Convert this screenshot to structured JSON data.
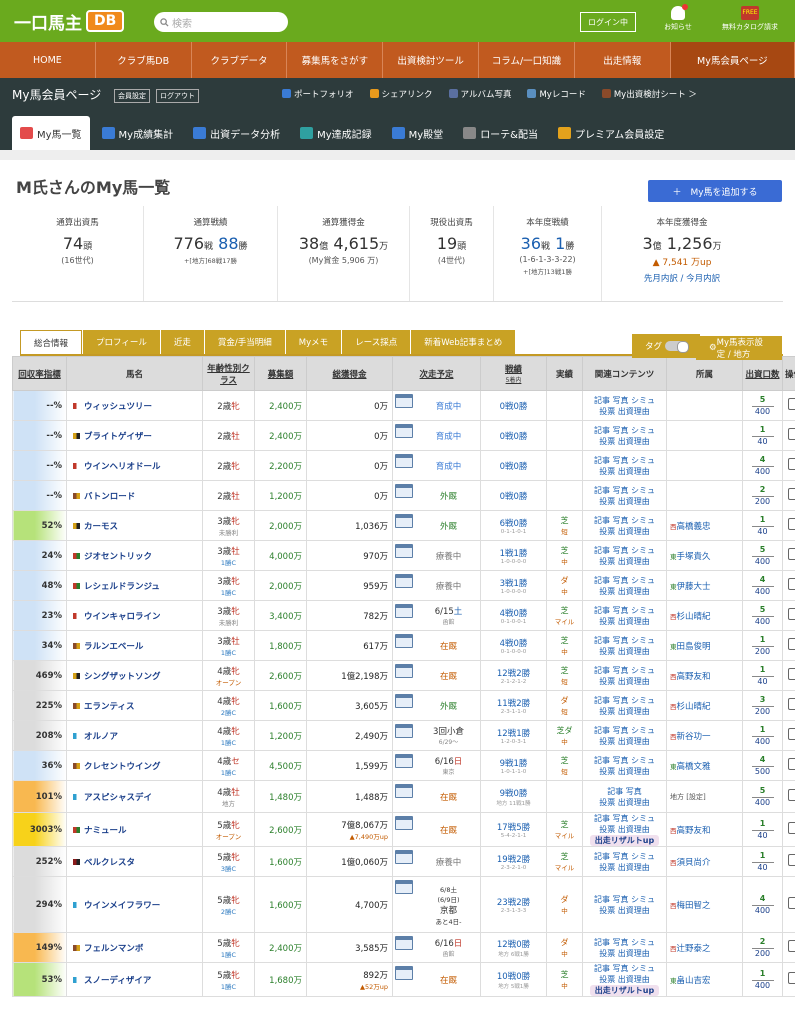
{
  "header": {
    "logo_text": "一口馬主",
    "logo_badge": "DB",
    "search_placeholder": "検索",
    "login_label": "ログイン中",
    "notice_label": "お知らせ",
    "catalog_label": "無料カタログ請求",
    "catalog_badge": "FREE"
  },
  "mainnav": [
    "HOME",
    "クラブ馬DB",
    "クラブデータ",
    "募集馬をさがす",
    "出資検討ツール",
    "コラム/一口知識",
    "出走情報",
    "My馬会員ページ"
  ],
  "subbar": {
    "title": "My馬会員ページ",
    "settings_label": "会員設定",
    "logout_label": "ログアウト",
    "links": [
      "ポートフォリオ",
      "シェアリンク",
      "アルバム写真",
      "Myレコード",
      "My出資検討シート ＞"
    ]
  },
  "tabs": [
    "My馬一覧",
    "My成績集計",
    "出資データ分析",
    "My達成記録",
    "My殿堂",
    "ローテ&配当",
    "プレミアム会員設定"
  ],
  "page": {
    "title": "M氏さんのMy馬一覧",
    "add_button": "＋　My馬を追加する"
  },
  "stats": [
    {
      "label": "通算出資馬",
      "v1": "74",
      "u1": "頭",
      "sub": "(16世代)"
    },
    {
      "label": "通算戦績",
      "v1": "776",
      "u1": "戦",
      "v2": "88",
      "u2": "勝",
      "sub": "+[地方]68戦17勝"
    },
    {
      "label": "通算獲得金",
      "v1": "38",
      "u1": "億",
      "v2": "4,615",
      "u2": "万",
      "sub": "(My賞金 5,906 万)"
    },
    {
      "label": "現役出資馬",
      "v1": "19",
      "u1": "頭",
      "sub": "(4世代)"
    },
    {
      "label": "本年度戦績",
      "v1": "36",
      "u1": "戦",
      "v2": "1",
      "u2": "勝",
      "sub": "(1-6-1-3-3-22)",
      "sub2": "+[地方]13戦1勝"
    },
    {
      "label": "本年度獲得金",
      "v1": "3",
      "u1": "億",
      "v2": "1,256",
      "u2": "万",
      "up": "7,541 万up",
      "link": "先月内訳 / 今月内訳"
    }
  ],
  "subtabs": [
    "総合情報",
    "プロフィール",
    "近走",
    "賞金/手当明細",
    "Myメモ",
    "レース採点",
    "新着Web記事まとめ"
  ],
  "toggle_label": "タグ",
  "display_settings": "My馬表示設定 / 地方",
  "columns": [
    "回収率指標",
    "馬名",
    "年齢性別クラス",
    "募集額",
    "総獲得金",
    "次走予定",
    "戦績",
    "実績",
    "関連コンテンツ",
    "所属",
    "出資口数",
    "操作"
  ],
  "columns_sub": {
    "record": "5着内"
  },
  "colors": {
    "green": "#6aaa1e",
    "orange": "#c15a1f",
    "dark": "#2d3b3c",
    "gold": "#c9a224",
    "link": "#1a5fb0"
  },
  "horses": [
    {
      "rate": "--%",
      "name": "ウィッシュツリー",
      "age": "2歳",
      "sex": "牝",
      "cls": "",
      "price": "2,400万",
      "earn": "0万",
      "earn_up": "",
      "next": "育成中",
      "next_sub": "",
      "rec": "0戦0勝",
      "rec_sub": "",
      "surf": "",
      "dist": "",
      "links": "記事 写真 シミュ|投票 出資理由",
      "badge": "",
      "stable": "",
      "stable_east": "",
      "sh": "5",
      "tot": "400",
      "tint": "#cfe2f6"
    },
    {
      "rate": "--%",
      "name": "ブライトゲイザー",
      "age": "2歳",
      "sex": "牡",
      "cls": "",
      "price": "2,400万",
      "earn": "0万",
      "earn_up": "",
      "next": "育成中",
      "next_sub": "",
      "rec": "0戦0勝",
      "rec_sub": "",
      "surf": "",
      "dist": "",
      "links": "記事 写真 シミュ|投票 出資理由",
      "badge": "",
      "stable": "",
      "stable_east": "",
      "sh": "1",
      "tot": "40",
      "tint": "#cfe2f6"
    },
    {
      "rate": "--%",
      "name": "ウインヘリオドール",
      "age": "2歳",
      "sex": "牝",
      "cls": "",
      "price": "2,200万",
      "earn": "0万",
      "earn_up": "",
      "next": "育成中",
      "next_sub": "",
      "rec": "0戦0勝",
      "rec_sub": "",
      "surf": "",
      "dist": "",
      "links": "記事 写真 シミュ|投票 出資理由",
      "badge": "",
      "stable": "",
      "stable_east": "",
      "sh": "4",
      "tot": "400",
      "tint": "#cfe2f6"
    },
    {
      "rate": "--%",
      "name": "バトンロード",
      "age": "2歳",
      "sex": "牡",
      "cls": "",
      "price": "1,200万",
      "earn": "0万",
      "earn_up": "",
      "next": "外厩",
      "next_sub": "",
      "rec": "0戦0勝",
      "rec_sub": "",
      "surf": "",
      "dist": "",
      "links": "記事 写真 シミュ|投票 出資理由",
      "badge": "",
      "stable": "",
      "stable_east": "",
      "sh": "2",
      "tot": "200",
      "tint": "#cfe2f6"
    },
    {
      "rate": "52%",
      "name": "カーモス",
      "age": "3歳",
      "sex": "牝",
      "cls": "未勝利",
      "price": "2,000万",
      "earn": "1,036万",
      "earn_up": "",
      "next": "外厩",
      "next_sub": "",
      "rec": "6戦0勝",
      "rec_sub": "0-1-1-0-1",
      "surf": "芝",
      "dist": "短",
      "links": "記事 写真 シミュ|投票 出資理由",
      "badge": "",
      "stable": "高橋義忠",
      "stable_east": "西",
      "sh": "1",
      "tot": "40",
      "tint": "#b6e27a"
    },
    {
      "rate": "24%",
      "name": "ジオセントリック",
      "age": "3歳",
      "sex": "牡",
      "cls": "1勝C",
      "price": "4,000万",
      "earn": "970万",
      "earn_up": "",
      "next": "療養中",
      "next_sub": "",
      "rec": "1戦1勝",
      "rec_sub": "1-0-0-0-0",
      "surf": "芝",
      "dist": "中",
      "links": "記事 写真 シミュ|投票 出資理由",
      "badge": "",
      "stable": "手塚貴久",
      "stable_east": "東",
      "sh": "5",
      "tot": "400",
      "tint": "#cfe2f6"
    },
    {
      "rate": "48%",
      "name": "レシェルドランジュ",
      "age": "3歳",
      "sex": "牝",
      "cls": "1勝C",
      "price": "2,000万",
      "earn": "959万",
      "earn_up": "",
      "next": "療養中",
      "next_sub": "",
      "rec": "3戦1勝",
      "rec_sub": "1-0-0-0-0",
      "surf": "ダ",
      "dist": "中",
      "links": "記事 写真 シミュ|投票 出資理由",
      "badge": "",
      "stable": "伊藤大士",
      "stable_east": "東",
      "sh": "4",
      "tot": "400",
      "tint": "#cfe2f6"
    },
    {
      "rate": "23%",
      "name": "ウインキャロライン",
      "age": "3歳",
      "sex": "牝",
      "cls": "未勝利",
      "price": "3,400万",
      "earn": "782万",
      "earn_up": "",
      "next": "6/15土",
      "next_sub": "函館",
      "rec": "4戦0勝",
      "rec_sub": "0-1-0-0-1",
      "surf": "芝",
      "dist": "マイル",
      "links": "記事 写真 シミュ|投票 出資理由",
      "badge": "",
      "stable": "杉山晴紀",
      "stable_east": "西",
      "sh": "5",
      "tot": "400",
      "tint": "#cfe2f6"
    },
    {
      "rate": "34%",
      "name": "ラルンエベール",
      "age": "3歳",
      "sex": "牡",
      "cls": "1勝C",
      "price": "1,800万",
      "earn": "617万",
      "earn_up": "",
      "next": "在厩",
      "next_sub": "",
      "rec": "4戦0勝",
      "rec_sub": "0-1-0-0-0",
      "surf": "芝",
      "dist": "中",
      "links": "記事 写真 シミュ|投票 出資理由",
      "badge": "",
      "stable": "田島俊明",
      "stable_east": "東",
      "sh": "1",
      "tot": "200",
      "tint": "#cfe2f6"
    },
    {
      "rate": "469%",
      "name": "シングザットソング",
      "age": "4歳",
      "sex": "牝",
      "cls": "オープン",
      "price": "2,600万",
      "earn": "1億2,198万",
      "earn_up": "",
      "next": "在厩",
      "next_sub": "",
      "rec": "12戦2勝",
      "rec_sub": "2-1-2-1-2",
      "surf": "芝",
      "dist": "短",
      "links": "記事 写真 シミュ|投票 出資理由",
      "badge": "",
      "stable": "高野友和",
      "stable_east": "西",
      "sh": "1",
      "tot": "40",
      "tint": "#dcdcdc"
    },
    {
      "rate": "225%",
      "name": "エランティス",
      "age": "4歳",
      "sex": "牝",
      "cls": "2勝C",
      "price": "1,600万",
      "earn": "3,605万",
      "earn_up": "",
      "next": "外厩",
      "next_sub": "",
      "rec": "11戦2勝",
      "rec_sub": "2-3-1-1-0",
      "surf": "ダ",
      "dist": "短",
      "links": "記事 写真 シミュ|投票 出資理由",
      "badge": "",
      "stable": "杉山晴紀",
      "stable_east": "西",
      "sh": "3",
      "tot": "200",
      "tint": "#dcdcdc"
    },
    {
      "rate": "208%",
      "name": "オルノア",
      "age": "4歳",
      "sex": "牝",
      "cls": "1勝C",
      "price": "1,200万",
      "earn": "2,490万",
      "earn_up": "",
      "next": "3回小倉",
      "next_sub": "6/29〜",
      "rec": "12戦1勝",
      "rec_sub": "1-2-0-3-1",
      "surf": "芝ダ",
      "dist": "中",
      "links": "記事 写真 シミュ|投票 出資理由",
      "badge": "",
      "stable": "新谷功一",
      "stable_east": "西",
      "sh": "1",
      "tot": "400",
      "tint": "#dcdcdc"
    },
    {
      "rate": "36%",
      "name": "クレセントウイング",
      "age": "4歳",
      "sex": "セ",
      "cls": "1勝C",
      "price": "4,500万",
      "earn": "1,599万",
      "earn_up": "",
      "next": "6/16日",
      "next_sub": "東京",
      "rec": "9戦1勝",
      "rec_sub": "1-0-1-1-0",
      "surf": "芝",
      "dist": "短",
      "links": "記事 写真 シミュ|投票 出資理由",
      "badge": "",
      "stable": "高橋文雅",
      "stable_east": "東",
      "sh": "4",
      "tot": "500",
      "tint": "#cfe2f6"
    },
    {
      "rate": "101%",
      "name": "アスピシャスデイ",
      "age": "4歳",
      "sex": "牡",
      "cls": "地方",
      "price": "1,480万",
      "earn": "1,488万",
      "earn_up": "",
      "next": "在厩",
      "next_sub": "",
      "rec": "9戦0勝",
      "rec_sub": "地方 11戦1勝",
      "surf": "",
      "dist": "",
      "links": "記事 写真|投票 出資理由",
      "badge": "",
      "stable": "地方 [設定]",
      "stable_east": "",
      "sh": "5",
      "tot": "400",
      "tint": "#f8b850"
    },
    {
      "rate": "3003%",
      "name": "ナミュール",
      "age": "5歳",
      "sex": "牝",
      "cls": "オープン",
      "price": "2,600万",
      "earn": "7億8,067万",
      "earn_up": "7,490万up",
      "next": "在厩",
      "next_sub": "",
      "rec": "17戦5勝",
      "rec_sub": "5-4-2-1-1",
      "surf": "芝",
      "dist": "マイル",
      "links": "記事 写真 シミュ|投票 出資理由",
      "badge": "出走リザルトup",
      "stable": "高野友和",
      "stable_east": "西",
      "sh": "1",
      "tot": "40",
      "tint": "#f7d21a"
    },
    {
      "rate": "252%",
      "name": "ベルクレスタ",
      "age": "5歳",
      "sex": "牝",
      "cls": "3勝C",
      "price": "1,600万",
      "earn": "1億0,060万",
      "earn_up": "",
      "next": "療養中",
      "next_sub": "",
      "rec": "19戦2勝",
      "rec_sub": "2-3-2-1-0",
      "surf": "芝",
      "dist": "マイル",
      "links": "記事 写真 シミュ|投票 出資理由",
      "badge": "",
      "stable": "須貝尚介",
      "stable_east": "西",
      "sh": "1",
      "tot": "40",
      "tint": "#dcdcdc"
    },
    {
      "rate": "294%",
      "name": "ウインメイフラワー",
      "age": "5歳",
      "sex": "牝",
      "cls": "2勝C",
      "price": "1,600万",
      "earn": "4,700万",
      "earn_up": "",
      "next": "6/8土|(6/9日)|京都|あと4日-",
      "next_sub": "",
      "rec": "23戦2勝",
      "rec_sub": "2-3-1-3-3",
      "surf": "ダ",
      "dist": "中",
      "links": "記事 写真 シミュ|投票 出資理由",
      "badge": "",
      "stable": "梅田智之",
      "stable_east": "西",
      "sh": "4",
      "tot": "400",
      "tint": "#dcdcdc"
    },
    {
      "rate": "149%",
      "name": "フェルンマンボ",
      "age": "5歳",
      "sex": "牝",
      "cls": "1勝C",
      "price": "2,400万",
      "earn": "3,585万",
      "earn_up": "",
      "next": "6/16日",
      "next_sub": "函館",
      "rec": "12戦0勝",
      "rec_sub": "地方 6戦1勝",
      "surf": "ダ",
      "dist": "中",
      "links": "記事 写真 シミュ|投票 出資理由",
      "badge": "",
      "stable": "辻野泰之",
      "stable_east": "西",
      "sh": "2",
      "tot": "200",
      "tint": "#f8b850"
    },
    {
      "rate": "53%",
      "name": "スノーディザイア",
      "age": "5歳",
      "sex": "牝",
      "cls": "1勝C",
      "price": "1,680万",
      "earn": "892万",
      "earn_up": "52万up",
      "next": "在厩",
      "next_sub": "",
      "rec": "10戦0勝",
      "rec_sub": "地方 5戦1勝",
      "surf": "芝",
      "dist": "中",
      "links": "記事 写真 シミュ|投票 出資理由",
      "badge": "出走リザルトup",
      "stable": "畠山吉宏",
      "stable_east": "東",
      "sh": "1",
      "tot": "400",
      "tint": "#b6e27a"
    }
  ]
}
